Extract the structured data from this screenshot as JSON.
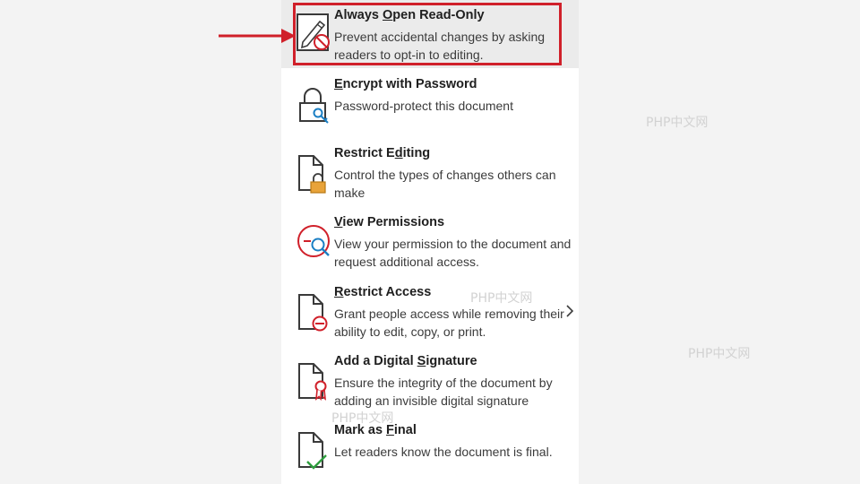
{
  "menu": {
    "items": [
      {
        "title_pre": "Always ",
        "title_key": "O",
        "title_post": "pen Read-Only",
        "description": "Prevent accidental changes by asking readers to opt-in to editing.",
        "icon": "pencil-blocked-icon"
      },
      {
        "title_pre": "",
        "title_key": "E",
        "title_post": "ncrypt with Password",
        "description": "Password-protect this document",
        "icon": "padlock-key-icon"
      },
      {
        "title_pre": "Restrict E",
        "title_key": "d",
        "title_post": "iting",
        "description": "Control the types of changes others can make",
        "icon": "document-lock-icon"
      },
      {
        "title_pre": "",
        "title_key": "V",
        "title_post": "iew Permissions",
        "description": "View your permission to the document and request additional access.",
        "icon": "magnifier-permissions-icon"
      },
      {
        "title_pre": "",
        "title_key": "R",
        "title_post": "estrict Access",
        "description": "Grant people access while removing their ability to edit, copy, or print.",
        "icon": "document-restricted-icon"
      },
      {
        "title_pre": "Add a Digital ",
        "title_key": "S",
        "title_post": "ignature",
        "description": "Ensure the integrity of the document by adding an invisible digital signature",
        "icon": "document-ribbon-icon"
      },
      {
        "title_pre": "Mark as ",
        "title_key": "F",
        "title_post": "inal",
        "description": "Let readers know the document is final.",
        "icon": "document-checkmark-icon"
      }
    ]
  },
  "watermark": "PHP中文网",
  "colors": {
    "highlight": "#d0202a",
    "accent_blue": "#1b7fc4",
    "lock_gold": "#e8a33a"
  }
}
